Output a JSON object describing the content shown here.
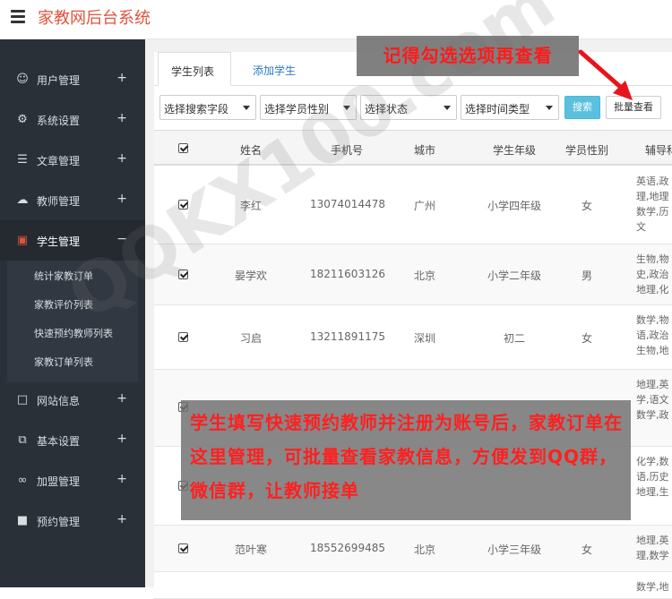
{
  "app": {
    "title": "家教网后台系统"
  },
  "sidebar": {
    "items": [
      {
        "label": "用户管理",
        "icon": "users-icon",
        "toggle": "+"
      },
      {
        "label": "系统设置",
        "icon": "gears-icon",
        "toggle": "+"
      },
      {
        "label": "文章管理",
        "icon": "list-icon",
        "toggle": "+"
      },
      {
        "label": "教师管理",
        "icon": "cloud-icon",
        "toggle": "+"
      },
      {
        "label": "学生管理",
        "icon": "save-icon",
        "toggle": "−"
      },
      {
        "label": "网站信息",
        "icon": "file-icon",
        "toggle": "+"
      },
      {
        "label": "基本设置",
        "icon": "copy-icon",
        "toggle": "+"
      },
      {
        "label": "加盟管理",
        "icon": "link-icon",
        "toggle": "+"
      },
      {
        "label": "预约管理",
        "icon": "book-icon",
        "toggle": "+"
      }
    ],
    "submenu": [
      "统计家教订单",
      "家教评价列表",
      "快速预约教师列表",
      "家教订单列表"
    ]
  },
  "tabs": {
    "list": "学生列表",
    "add": "添加学生"
  },
  "filters": {
    "field": "选择搜索字段",
    "gender": "选择学员性别",
    "status": "选择状态",
    "time": "选择时间类型",
    "search": "搜索",
    "batch": "批量查看"
  },
  "table": {
    "headers": [
      "姓名",
      "手机号",
      "城市",
      "学生年级",
      "学员性别",
      "辅导科"
    ],
    "rows": [
      {
        "name": "李红",
        "phone": "13074014478",
        "city": "广州",
        "grade": "小学四年级",
        "gender": "女",
        "subjects": "英语,政\n理,地理\n数学,历\n文"
      },
      {
        "name": "晏学欢",
        "phone": "18211603126",
        "city": "北京",
        "grade": "小学二年级",
        "gender": "男",
        "subjects": "生物,物\n史,政治\n地理,化"
      },
      {
        "name": "习启",
        "phone": "13211891175",
        "city": "深圳",
        "grade": "初二",
        "gender": "女",
        "subjects": "数学,物\n语,政治\n生物,地"
      },
      {
        "name": "",
        "phone": "",
        "city": "",
        "grade": "",
        "gender": "",
        "subjects": "地理,英\n学,语文\n数学,政"
      },
      {
        "name": "",
        "phone": "",
        "city": "",
        "grade": "",
        "gender": "",
        "subjects": "化学,数\n语,历史\n地理,生"
      },
      {
        "name": "范叶寒",
        "phone": "18552699485",
        "city": "北京",
        "grade": "小学三年级",
        "gender": "女",
        "subjects": "地理,英\n理,数学"
      },
      {
        "name": "",
        "phone": "",
        "city": "",
        "grade": "",
        "gender": "",
        "subjects": "数学,地"
      }
    ]
  },
  "annotations": {
    "top": "记得勾选选项再查看",
    "big": "学生填写快速预约教师并注册为账号后，家教订单在这里管理，可批量查看家教信息，方便发到QQ群，微信群，让教师接单",
    "watermark": "QQKX100.com"
  },
  "colors": {
    "brand": "#e0533c",
    "sidebar": "#2a3038",
    "info": "#5bc0de",
    "link": "#2b7bc2",
    "annotation": "#ff1a1a"
  }
}
